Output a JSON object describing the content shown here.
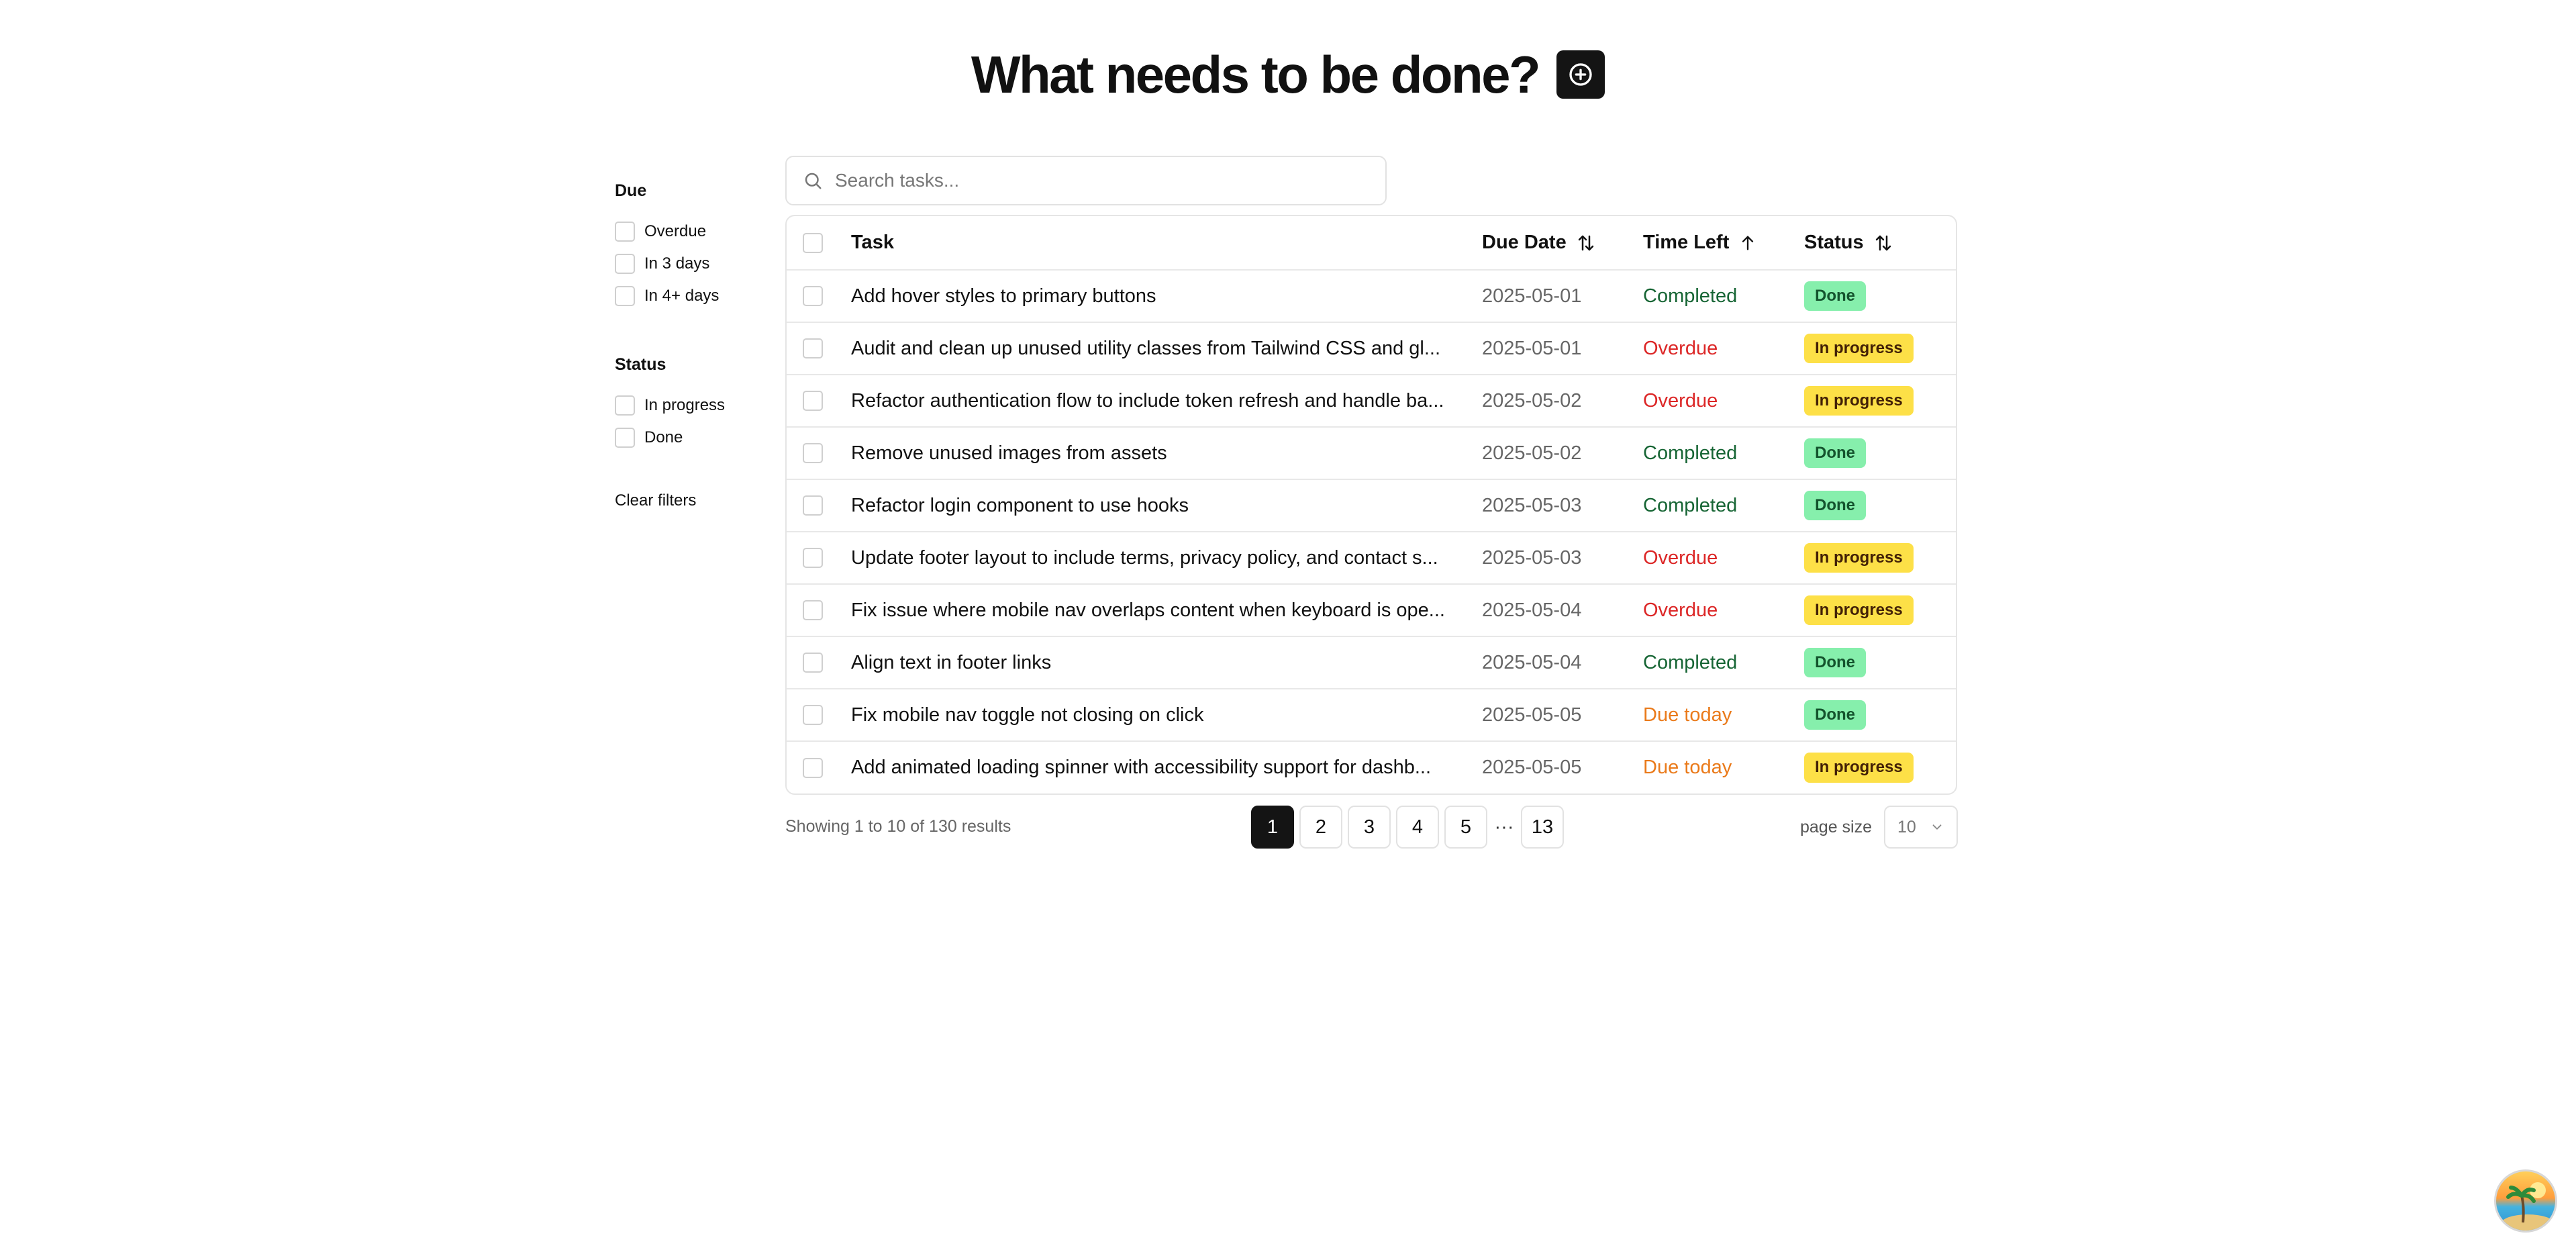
{
  "header": {
    "title": "What needs to be done?"
  },
  "filters": {
    "due": {
      "heading": "Due",
      "options": [
        "Overdue",
        "In 3 days",
        "In 4+ days"
      ]
    },
    "status": {
      "heading": "Status",
      "options": [
        "In progress",
        "Done"
      ]
    },
    "clear_label": "Clear filters"
  },
  "search": {
    "placeholder": "Search tasks...",
    "value": ""
  },
  "table": {
    "columns": {
      "task": "Task",
      "due_date": "Due Date",
      "time_left": "Time Left",
      "status": "Status"
    },
    "rows": [
      {
        "task": "Add hover styles to primary buttons",
        "due": "2025-05-01",
        "time_left": "Completed",
        "status": "Done"
      },
      {
        "task": "Audit and clean up unused utility classes from Tailwind CSS and gl...",
        "due": "2025-05-01",
        "time_left": "Overdue",
        "status": "In progress"
      },
      {
        "task": "Refactor authentication flow to include token refresh and handle ba...",
        "due": "2025-05-02",
        "time_left": "Overdue",
        "status": "In progress"
      },
      {
        "task": "Remove unused images from assets",
        "due": "2025-05-02",
        "time_left": "Completed",
        "status": "Done"
      },
      {
        "task": "Refactor login component to use hooks",
        "due": "2025-05-03",
        "time_left": "Completed",
        "status": "Done"
      },
      {
        "task": "Update footer layout to include terms, privacy policy, and contact s...",
        "due": "2025-05-03",
        "time_left": "Overdue",
        "status": "In progress"
      },
      {
        "task": "Fix issue where mobile nav overlaps content when keyboard is ope...",
        "due": "2025-05-04",
        "time_left": "Overdue",
        "status": "In progress"
      },
      {
        "task": "Align text in footer links",
        "due": "2025-05-04",
        "time_left": "Completed",
        "status": "Done"
      },
      {
        "task": "Fix mobile nav toggle not closing on click",
        "due": "2025-05-05",
        "time_left": "Due today",
        "status": "Done"
      },
      {
        "task": "Add animated loading spinner with accessibility support for dashb...",
        "due": "2025-05-05",
        "time_left": "Due today",
        "status": "In progress"
      }
    ]
  },
  "footer": {
    "results_text": "Showing 1 to 10 of 130 results",
    "pages": [
      "1",
      "2",
      "3",
      "4",
      "5"
    ],
    "ellipsis": "···",
    "last_page": "13",
    "current_page": "1",
    "page_size_label": "page size",
    "page_size_value": "10"
  },
  "colors": {
    "completed": "#166534",
    "overdue": "#dc2626",
    "due_today": "#ea7a1a",
    "badge_done": "#86efac",
    "badge_in_progress": "#fde047",
    "primary_dark": "#141414"
  },
  "icons": {
    "add": "plus-circle-icon",
    "search": "search-icon",
    "sort": "arrow-up-down-icon",
    "sort_asc": "arrow-up-icon",
    "select": "chevron-down-icon",
    "assistant": "assistant-avatar-icon"
  }
}
